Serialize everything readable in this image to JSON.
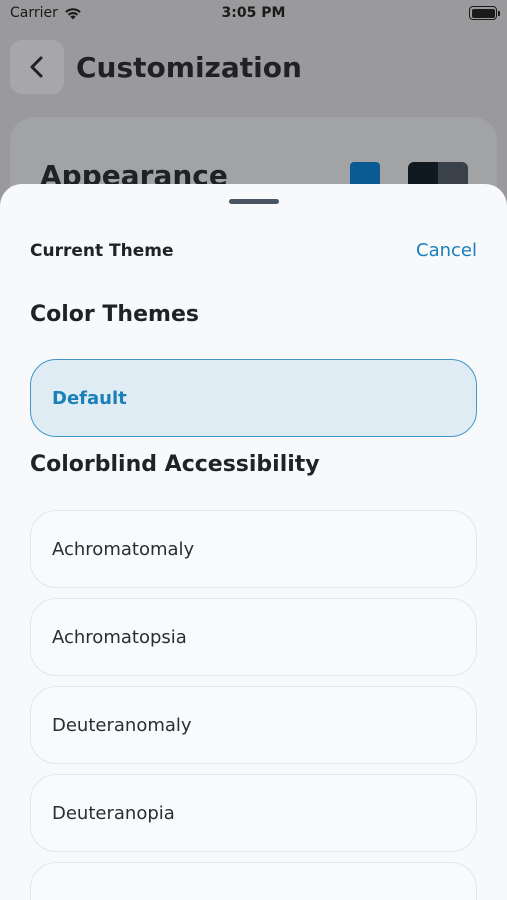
{
  "status_bar": {
    "carrier": "Carrier",
    "time": "3:05 PM"
  },
  "header": {
    "title": "Customization",
    "back_icon": "chevron-left-icon"
  },
  "appearance_card": {
    "title": "Appearance",
    "swatch_colors": [
      "#0a5a94",
      "#101820",
      "#3a414b"
    ]
  },
  "sheet": {
    "current_theme_label": "Current Theme",
    "cancel_label": "Cancel",
    "color_themes_title": "Color Themes",
    "color_themes": [
      {
        "label": "Default",
        "selected": true
      }
    ],
    "colorblind_title": "Colorblind Accessibility",
    "colorblind_options": [
      {
        "label": "Achromatomaly"
      },
      {
        "label": "Achromatopsia"
      },
      {
        "label": "Deuteranomaly"
      },
      {
        "label": "Deuteranopia"
      },
      {
        "label": ""
      }
    ]
  },
  "colors": {
    "accent": "#1b7fb8",
    "selected_bg": "#e0ecf4",
    "sheet_bg": "#f7f9fb"
  }
}
